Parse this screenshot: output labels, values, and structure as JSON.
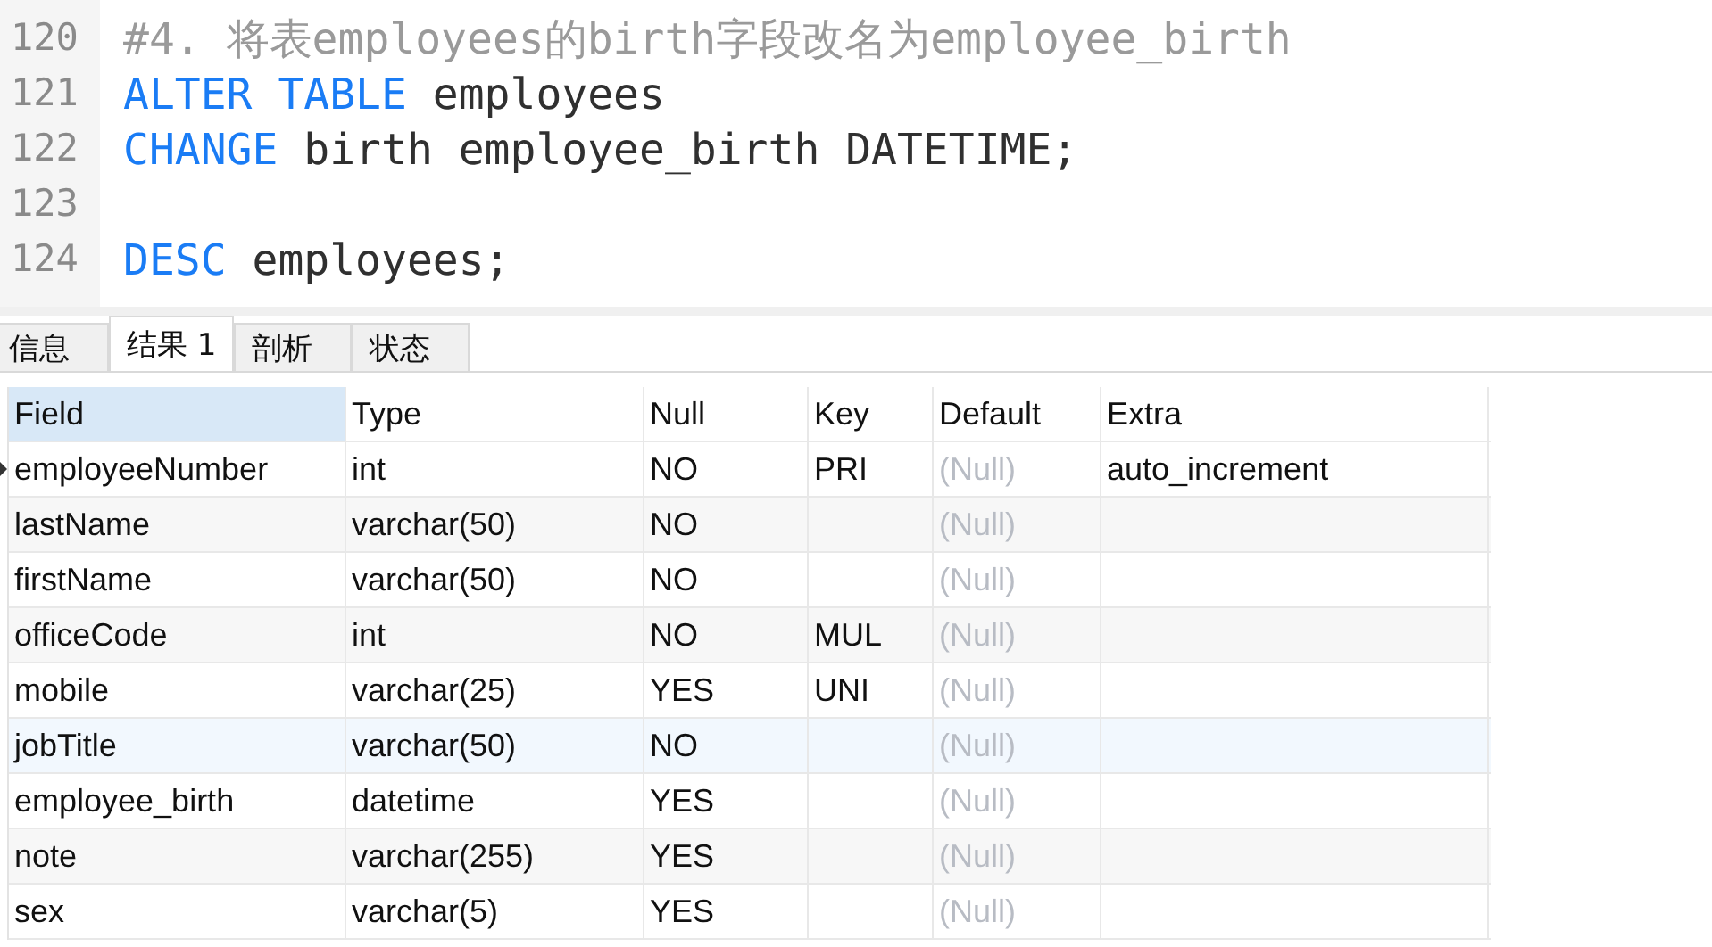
{
  "editor": {
    "lines": [
      {
        "number": "120",
        "tokens": [
          {
            "kind": "comment",
            "text": "#4. 将表employees的birth字段改名为employee_birth"
          }
        ]
      },
      {
        "number": "121",
        "tokens": [
          {
            "kind": "keyword",
            "text": "ALTER TABLE"
          },
          {
            "kind": "plain",
            "text": " employees"
          }
        ]
      },
      {
        "number": "122",
        "tokens": [
          {
            "kind": "keyword",
            "text": "CHANGE"
          },
          {
            "kind": "plain",
            "text": " birth employee_birth DATETIME;"
          }
        ]
      },
      {
        "number": "123"
      },
      {
        "number": "124",
        "tokens": [
          {
            "kind": "keyword",
            "text": "DESC"
          },
          {
            "kind": "plain",
            "text": " employees;"
          }
        ]
      }
    ]
  },
  "tabs": [
    {
      "label": "信息",
      "selected": false
    },
    {
      "label": "结果 1",
      "selected": true
    },
    {
      "label": "剖析",
      "selected": false
    },
    {
      "label": "状态",
      "selected": false
    }
  ],
  "table": {
    "columns": [
      {
        "label": "Field",
        "selected": true
      },
      {
        "label": "Type",
        "selected": false
      },
      {
        "label": "Null",
        "selected": false
      },
      {
        "label": "Key",
        "selected": false
      },
      {
        "label": "Default",
        "selected": false
      },
      {
        "label": "Extra",
        "selected": false
      }
    ],
    "rows": [
      {
        "current": true,
        "highlighted": false,
        "cells": [
          {
            "text": "employeeNumber"
          },
          {
            "text": "int"
          },
          {
            "text": "NO"
          },
          {
            "text": "PRI"
          },
          {
            "text": "(Null)",
            "is_null": true
          },
          {
            "text": "auto_increment"
          }
        ]
      },
      {
        "current": false,
        "highlighted": false,
        "cells": [
          {
            "text": "lastName"
          },
          {
            "text": "varchar(50)"
          },
          {
            "text": "NO"
          },
          {},
          {
            "text": "(Null)",
            "is_null": true
          },
          {}
        ]
      },
      {
        "current": false,
        "highlighted": false,
        "cells": [
          {
            "text": "firstName"
          },
          {
            "text": "varchar(50)"
          },
          {
            "text": "NO"
          },
          {},
          {
            "text": "(Null)",
            "is_null": true
          },
          {}
        ]
      },
      {
        "current": false,
        "highlighted": false,
        "cells": [
          {
            "text": "officeCode"
          },
          {
            "text": "int"
          },
          {
            "text": "NO"
          },
          {
            "text": "MUL"
          },
          {
            "text": "(Null)",
            "is_null": true
          },
          {}
        ]
      },
      {
        "current": false,
        "highlighted": false,
        "cells": [
          {
            "text": "mobile"
          },
          {
            "text": "varchar(25)"
          },
          {
            "text": "YES"
          },
          {
            "text": "UNI"
          },
          {
            "text": "(Null)",
            "is_null": true
          },
          {}
        ]
      },
      {
        "current": false,
        "highlighted": true,
        "cells": [
          {
            "text": "jobTitle"
          },
          {
            "text": "varchar(50)"
          },
          {
            "text": "NO"
          },
          {},
          {
            "text": "(Null)",
            "is_null": true
          },
          {}
        ]
      },
      {
        "current": false,
        "highlighted": false,
        "cells": [
          {
            "text": "employee_birth"
          },
          {
            "text": "datetime"
          },
          {
            "text": "YES"
          },
          {},
          {
            "text": "(Null)",
            "is_null": true
          },
          {}
        ]
      },
      {
        "current": false,
        "highlighted": false,
        "cells": [
          {
            "text": "note"
          },
          {
            "text": "varchar(255)"
          },
          {
            "text": "YES"
          },
          {},
          {
            "text": "(Null)",
            "is_null": true
          },
          {}
        ]
      },
      {
        "current": false,
        "highlighted": false,
        "cells": [
          {
            "text": "sex"
          },
          {
            "text": "varchar(5)"
          },
          {
            "text": "YES"
          },
          {},
          {
            "text": "(Null)",
            "is_null": true
          },
          {}
        ]
      }
    ]
  }
}
